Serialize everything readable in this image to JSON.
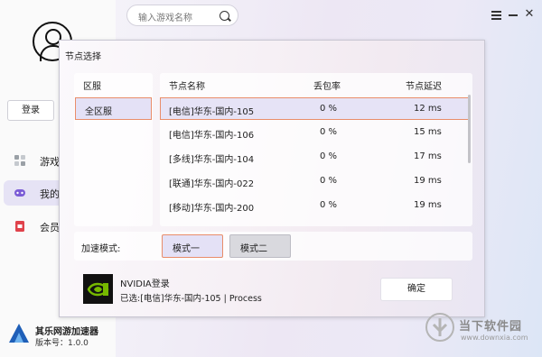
{
  "search": {
    "placeholder": "输入游戏名称"
  },
  "sidebar": {
    "login_label": "登录",
    "items": [
      {
        "label": "游戏",
        "icon": "games-grid-icon"
      },
      {
        "label": "我的",
        "icon": "gamepad-icon"
      },
      {
        "label": "会员",
        "icon": "vip-icon"
      }
    ],
    "app_name": "其乐网游加速器",
    "version": "版本号：1.0.0"
  },
  "dialog": {
    "title": "节点选择",
    "region_header": "区服",
    "region_selected": "全区服",
    "columns": {
      "name": "节点名称",
      "loss": "丢包率",
      "delay": "节点延迟"
    },
    "rows": [
      {
        "name": "[电信]华东-国内-105",
        "loss": "0 %",
        "delay": "12 ms",
        "selected": true
      },
      {
        "name": "[电信]华东-国内-106",
        "loss": "0 %",
        "delay": "15 ms"
      },
      {
        "name": "[多线]华东-国内-104",
        "loss": "0 %",
        "delay": "17 ms"
      },
      {
        "name": "[联通]华东-国内-022",
        "loss": "0 %",
        "delay": "19 ms"
      },
      {
        "name": "[移动]华东-国内-200",
        "loss": "0 %",
        "delay": "19 ms"
      }
    ],
    "mode_label": "加速模式:",
    "modes": [
      "模式一",
      "模式二"
    ],
    "game_name": "NVIDIA登录",
    "selected_info": "已选:[电信]华东-国内-105 | Process",
    "confirm_label": "确定"
  },
  "watermark": {
    "name": "当下软件园",
    "url": "www.downxia.com"
  },
  "colors": {
    "accent_border": "#e98d6a",
    "selected_bg": "#e4e1f6",
    "nvidia_green": "#76b900"
  }
}
